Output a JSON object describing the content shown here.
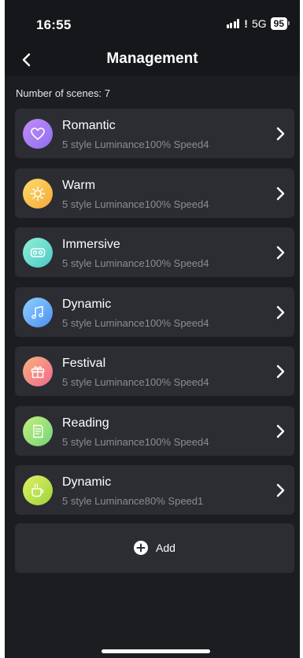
{
  "status_bar": {
    "time": "16:55",
    "network": "5G",
    "battery": "95"
  },
  "header": {
    "title": "Management",
    "back_icon": "chevron-left-icon"
  },
  "scenes_count_label": "Number of scenes: 7",
  "scenes": [
    {
      "name": "Romantic",
      "description": "5 style Luminance100% Speed4",
      "icon": "heart-icon",
      "colors": [
        "#c38cf7",
        "#8e6ff0"
      ]
    },
    {
      "name": "Warm",
      "description": "5 style Luminance100% Speed4",
      "icon": "sun-icon",
      "colors": [
        "#fbdc6a",
        "#f4a83a"
      ]
    },
    {
      "name": "Immersive",
      "description": "5 style Luminance100% Speed4",
      "icon": "vr-headset-icon",
      "colors": [
        "#8ff2d6",
        "#4cc7c9"
      ]
    },
    {
      "name": "Dynamic",
      "description": "5 style Luminance100% Speed4",
      "icon": "music-note-icon",
      "colors": [
        "#8ed1ff",
        "#4c8ef0"
      ]
    },
    {
      "name": "Festival",
      "description": "5 style Luminance100% Speed4",
      "icon": "gift-icon",
      "colors": [
        "#f8b27c",
        "#ee6a8d"
      ]
    },
    {
      "name": "Reading",
      "description": "5 style Luminance100% Speed4",
      "icon": "document-icon",
      "colors": [
        "#c6f07a",
        "#72d37a"
      ]
    },
    {
      "name": "Dynamic",
      "description": "5 style Luminance80% Speed1",
      "icon": "coffee-cup-icon",
      "colors": [
        "#e0f064",
        "#9bd43c"
      ]
    }
  ],
  "add_button": {
    "label": "Add",
    "icon": "plus-circle-icon"
  }
}
